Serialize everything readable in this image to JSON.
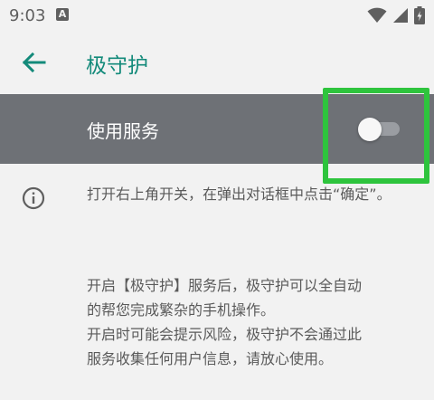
{
  "status": {
    "time": "9:03",
    "notification_badge": "A"
  },
  "appbar": {
    "title": "极守护"
  },
  "service": {
    "label": "使用服务",
    "enabled": false
  },
  "hint": {
    "text": "打开右上角开关，在弹出对话框中点击“确定”。"
  },
  "description": {
    "lines": [
      "开启【极守护】服务后，极守护可以全自动",
      "的帮您完成繁杂的手机操作。",
      "开启时可能会提示风险，极守护不会通过此",
      "服务收集任何用户信息，请放心使用。"
    ]
  },
  "colors": {
    "accent": "#138a7a",
    "service_bg": "#6e7176",
    "highlight": "#2ec43d"
  },
  "icons": [
    "back-arrow-icon",
    "info-icon",
    "wifi-icon",
    "signal-icon",
    "battery-icon"
  ]
}
